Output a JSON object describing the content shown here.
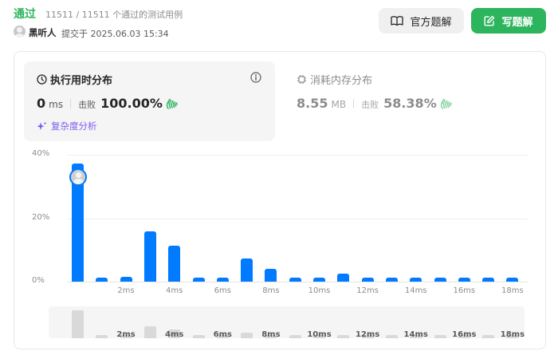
{
  "header": {
    "status": "通过",
    "pass_count": "11511 / 11511 个通过的测试用例",
    "user_name": "黑听人",
    "submit_time": "提交于 2025.06.03 15:34"
  },
  "buttons": {
    "official_solution": "官方题解",
    "write_solution": "写题解"
  },
  "runtime": {
    "title": "执行用时分布",
    "value": "0",
    "unit": "ms",
    "beats_label": "击败",
    "beats_value": "100.00%",
    "complexity_label": "复杂度分析"
  },
  "memory": {
    "title": "消耗内存分布",
    "value": "8.55",
    "unit": "MB",
    "beats_label": "击败",
    "beats_value": "58.38%"
  },
  "colors": {
    "accent_green": "#2db55d",
    "bar_blue": "#007aff",
    "complexity_purple": "#7c5cf0"
  },
  "chart_data": {
    "type": "bar",
    "xlabel": "",
    "ylabel": "",
    "ylim": [
      0,
      40
    ],
    "y_ticks": [
      "40%",
      "20%",
      "0%"
    ],
    "x_ticks": [
      "2ms",
      "4ms",
      "6ms",
      "8ms",
      "10ms",
      "12ms",
      "14ms",
      "16ms",
      "18ms"
    ],
    "x_tick_values": [
      2,
      4,
      6,
      8,
      10,
      12,
      14,
      16,
      18
    ],
    "x": [
      0,
      1,
      2,
      3,
      4,
      5,
      6,
      7,
      8,
      9,
      10,
      11,
      12,
      13,
      14,
      15,
      16,
      17,
      18
    ],
    "values": [
      37.2,
      1.3,
      1.4,
      15.8,
      11.2,
      1.2,
      1.2,
      7.2,
      4.0,
      1.2,
      1.2,
      2.6,
      1.2,
      1.2,
      1.2,
      1.2,
      1.2,
      1.2,
      1.2
    ],
    "highlight_index": 0,
    "grid": true
  }
}
